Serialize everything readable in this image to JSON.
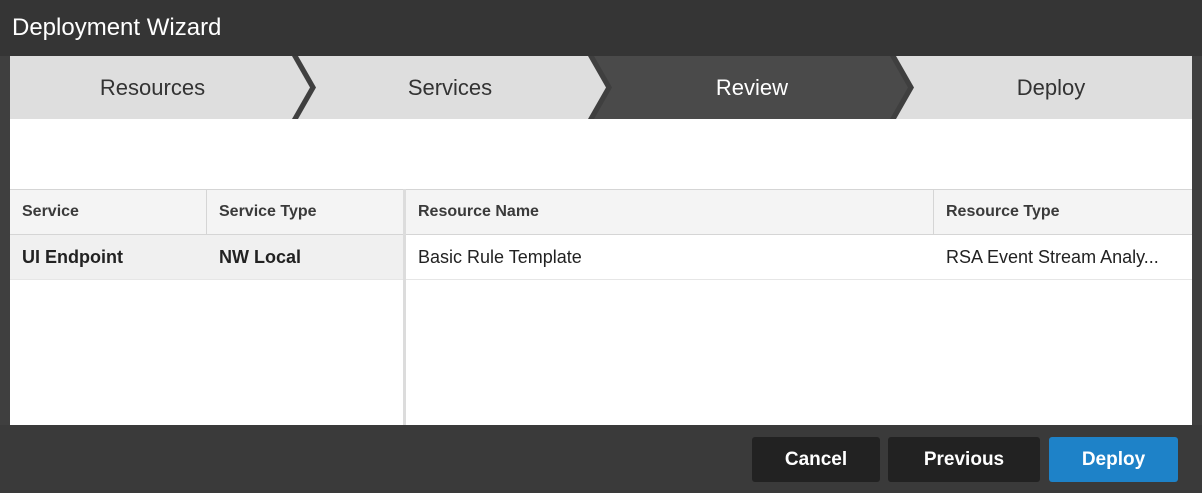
{
  "window": {
    "title": "Deployment Wizard"
  },
  "steps": [
    {
      "label": "Resources",
      "active": false
    },
    {
      "label": "Services",
      "active": false
    },
    {
      "label": "Review",
      "active": true
    },
    {
      "label": "Deploy",
      "active": false
    }
  ],
  "services_table": {
    "columns": [
      "Service",
      "Service Type"
    ],
    "rows": [
      {
        "service": "UI Endpoint",
        "service_type": "NW Local"
      }
    ]
  },
  "resources_table": {
    "columns": [
      "Resource Name",
      "Resource Type"
    ],
    "rows": [
      {
        "resource_name": "Basic Rule Template",
        "resource_type": "RSA Event Stream Analy..."
      }
    ]
  },
  "footer": {
    "cancel_label": "Cancel",
    "previous_label": "Previous",
    "deploy_label": "Deploy"
  },
  "colors": {
    "accent": "#1e82c8",
    "step_inactive": "#dedede",
    "step_active": "#4a4a4a",
    "titlebar": "#353535"
  }
}
